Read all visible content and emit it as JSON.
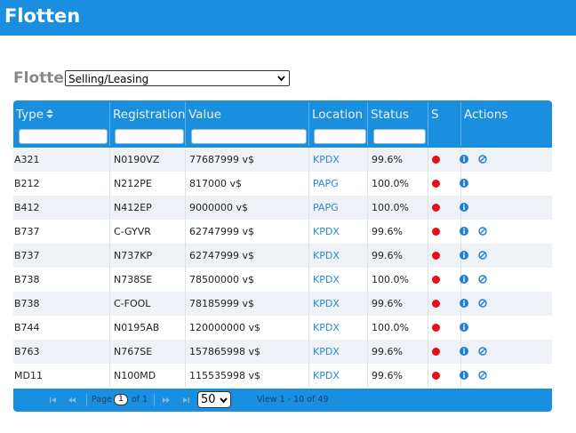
{
  "app": {
    "title": "Flotten"
  },
  "filter": {
    "label": "Flotte:",
    "selected": "Selling/Leasing"
  },
  "columns": [
    "Type",
    "Registration",
    "Value",
    "Location",
    "Status",
    "S",
    "Actions"
  ],
  "rows": [
    {
      "type": "A321",
      "registration": "N0190VZ",
      "value": "77687999 v$",
      "location": "KPDX",
      "status": "99.6%",
      "ban": true
    },
    {
      "type": "B212",
      "registration": "N212PE",
      "value": "817000 v$",
      "location": "PAPG",
      "status": "100.0%",
      "ban": false
    },
    {
      "type": "B412",
      "registration": "N412EP",
      "value": "9000000 v$",
      "location": "PAPG",
      "status": "100.0%",
      "ban": false
    },
    {
      "type": "B737",
      "registration": "C-GYVR",
      "value": "62747999 v$",
      "location": "KPDX",
      "status": "99.6%",
      "ban": true
    },
    {
      "type": "B737",
      "registration": "N737KP",
      "value": "62747999 v$",
      "location": "KPDX",
      "status": "99.6%",
      "ban": true
    },
    {
      "type": "B738",
      "registration": "N738SE",
      "value": "78500000 v$",
      "location": "KPDX",
      "status": "100.0%",
      "ban": true
    },
    {
      "type": "B738",
      "registration": "C-FOOL",
      "value": "78185999 v$",
      "location": "KPDX",
      "status": "99.6%",
      "ban": true
    },
    {
      "type": "B744",
      "registration": "N0195AB",
      "value": "120000000 v$",
      "location": "KPDX",
      "status": "100.0%",
      "ban": false
    },
    {
      "type": "B763",
      "registration": "N767SE",
      "value": "157865998 v$",
      "location": "KPDX",
      "status": "99.6%",
      "ban": true
    },
    {
      "type": "MD11",
      "registration": "N100MD",
      "value": "115535998 v$",
      "location": "KPDX",
      "status": "99.6%",
      "ban": true
    }
  ],
  "pager": {
    "page_label": "Page",
    "page_value": "1",
    "of_label": "of 1",
    "rows_per_page": "50",
    "view_text": "View 1 - 10 of 49"
  },
  "colors": {
    "accent": "#1a8fe0",
    "status_dot": "#e3101c",
    "location_link": "#2a87d8"
  },
  "icons": [
    "sort-icon",
    "status-dot-icon",
    "info-icon",
    "ban-icon",
    "first-page-icon",
    "prev-page-icon",
    "next-page-icon",
    "last-page-icon",
    "chevron-down-icon"
  ]
}
